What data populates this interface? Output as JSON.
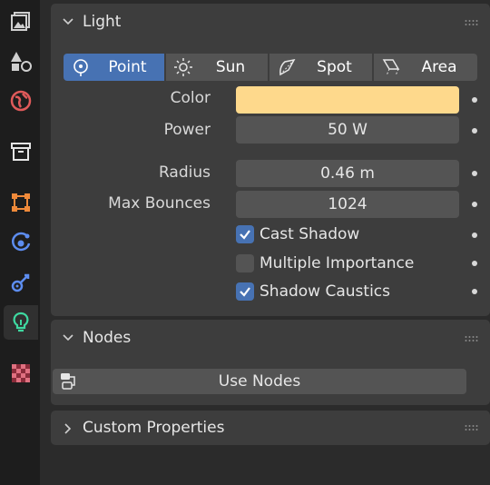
{
  "sidebar": {
    "tabs": [
      {
        "icon": "image-icon",
        "active": false
      },
      {
        "icon": "shapes-icon",
        "active": false
      },
      {
        "icon": "world-icon",
        "active": false
      },
      {
        "icon": "collection-icon",
        "active": false
      },
      {
        "icon": "object-icon",
        "active": false
      },
      {
        "icon": "physics-icon",
        "active": false
      },
      {
        "icon": "constraint-icon",
        "active": false
      },
      {
        "icon": "light-bulb-icon",
        "active": true
      },
      {
        "icon": "texture-checker-icon",
        "active": false
      }
    ]
  },
  "light_panel": {
    "title": "Light",
    "types": [
      {
        "label": "Point",
        "icon": "point-light-icon",
        "active": true
      },
      {
        "label": "Sun",
        "icon": "sun-light-icon",
        "active": false
      },
      {
        "label": "Spot",
        "icon": "spot-light-icon",
        "active": false
      },
      {
        "label": "Area",
        "icon": "area-light-icon",
        "active": false
      }
    ],
    "color_label": "Color",
    "color_value": "#fed98c",
    "power_label": "Power",
    "power_value": "50 W",
    "radius_label": "Radius",
    "radius_value": "0.46 m",
    "max_bounces_label": "Max Bounces",
    "max_bounces_value": "1024",
    "checkboxes": [
      {
        "label": "Cast Shadow",
        "checked": true
      },
      {
        "label": "Multiple Importance",
        "checked": false
      },
      {
        "label": "Shadow Caustics",
        "checked": true
      }
    ]
  },
  "nodes_panel": {
    "title": "Nodes",
    "use_nodes_label": "Use Nodes"
  },
  "custom_props_panel": {
    "title": "Custom Properties"
  },
  "colors": {
    "accent": "#4772b3",
    "panel": "#3d3d3d",
    "field": "#545454",
    "active_tab_icon": "#3ed8a0"
  }
}
